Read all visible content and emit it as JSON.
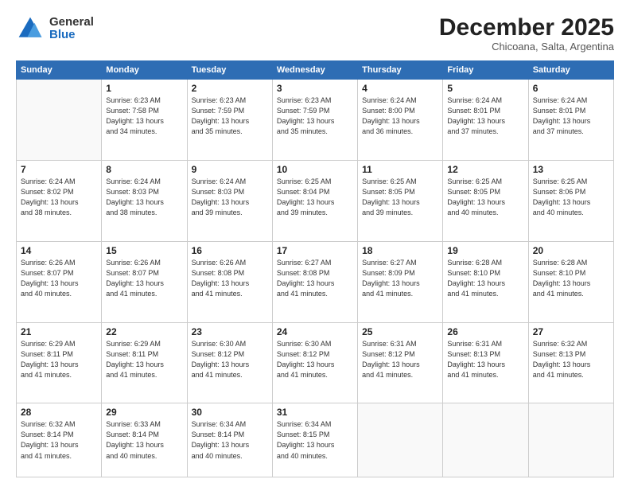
{
  "logo": {
    "general": "General",
    "blue": "Blue"
  },
  "header": {
    "month": "December 2025",
    "location": "Chicoana, Salta, Argentina"
  },
  "days_of_week": [
    "Sunday",
    "Monday",
    "Tuesday",
    "Wednesday",
    "Thursday",
    "Friday",
    "Saturday"
  ],
  "weeks": [
    [
      {
        "day": "",
        "info": ""
      },
      {
        "day": "1",
        "info": "Sunrise: 6:23 AM\nSunset: 7:58 PM\nDaylight: 13 hours\nand 34 minutes."
      },
      {
        "day": "2",
        "info": "Sunrise: 6:23 AM\nSunset: 7:59 PM\nDaylight: 13 hours\nand 35 minutes."
      },
      {
        "day": "3",
        "info": "Sunrise: 6:23 AM\nSunset: 7:59 PM\nDaylight: 13 hours\nand 35 minutes."
      },
      {
        "day": "4",
        "info": "Sunrise: 6:24 AM\nSunset: 8:00 PM\nDaylight: 13 hours\nand 36 minutes."
      },
      {
        "day": "5",
        "info": "Sunrise: 6:24 AM\nSunset: 8:01 PM\nDaylight: 13 hours\nand 37 minutes."
      },
      {
        "day": "6",
        "info": "Sunrise: 6:24 AM\nSunset: 8:01 PM\nDaylight: 13 hours\nand 37 minutes."
      }
    ],
    [
      {
        "day": "7",
        "info": "Sunrise: 6:24 AM\nSunset: 8:02 PM\nDaylight: 13 hours\nand 38 minutes."
      },
      {
        "day": "8",
        "info": "Sunrise: 6:24 AM\nSunset: 8:03 PM\nDaylight: 13 hours\nand 38 minutes."
      },
      {
        "day": "9",
        "info": "Sunrise: 6:24 AM\nSunset: 8:03 PM\nDaylight: 13 hours\nand 39 minutes."
      },
      {
        "day": "10",
        "info": "Sunrise: 6:25 AM\nSunset: 8:04 PM\nDaylight: 13 hours\nand 39 minutes."
      },
      {
        "day": "11",
        "info": "Sunrise: 6:25 AM\nSunset: 8:05 PM\nDaylight: 13 hours\nand 39 minutes."
      },
      {
        "day": "12",
        "info": "Sunrise: 6:25 AM\nSunset: 8:05 PM\nDaylight: 13 hours\nand 40 minutes."
      },
      {
        "day": "13",
        "info": "Sunrise: 6:25 AM\nSunset: 8:06 PM\nDaylight: 13 hours\nand 40 minutes."
      }
    ],
    [
      {
        "day": "14",
        "info": "Sunrise: 6:26 AM\nSunset: 8:07 PM\nDaylight: 13 hours\nand 40 minutes."
      },
      {
        "day": "15",
        "info": "Sunrise: 6:26 AM\nSunset: 8:07 PM\nDaylight: 13 hours\nand 41 minutes."
      },
      {
        "day": "16",
        "info": "Sunrise: 6:26 AM\nSunset: 8:08 PM\nDaylight: 13 hours\nand 41 minutes."
      },
      {
        "day": "17",
        "info": "Sunrise: 6:27 AM\nSunset: 8:08 PM\nDaylight: 13 hours\nand 41 minutes."
      },
      {
        "day": "18",
        "info": "Sunrise: 6:27 AM\nSunset: 8:09 PM\nDaylight: 13 hours\nand 41 minutes."
      },
      {
        "day": "19",
        "info": "Sunrise: 6:28 AM\nSunset: 8:10 PM\nDaylight: 13 hours\nand 41 minutes."
      },
      {
        "day": "20",
        "info": "Sunrise: 6:28 AM\nSunset: 8:10 PM\nDaylight: 13 hours\nand 41 minutes."
      }
    ],
    [
      {
        "day": "21",
        "info": "Sunrise: 6:29 AM\nSunset: 8:11 PM\nDaylight: 13 hours\nand 41 minutes."
      },
      {
        "day": "22",
        "info": "Sunrise: 6:29 AM\nSunset: 8:11 PM\nDaylight: 13 hours\nand 41 minutes."
      },
      {
        "day": "23",
        "info": "Sunrise: 6:30 AM\nSunset: 8:12 PM\nDaylight: 13 hours\nand 41 minutes."
      },
      {
        "day": "24",
        "info": "Sunrise: 6:30 AM\nSunset: 8:12 PM\nDaylight: 13 hours\nand 41 minutes."
      },
      {
        "day": "25",
        "info": "Sunrise: 6:31 AM\nSunset: 8:12 PM\nDaylight: 13 hours\nand 41 minutes."
      },
      {
        "day": "26",
        "info": "Sunrise: 6:31 AM\nSunset: 8:13 PM\nDaylight: 13 hours\nand 41 minutes."
      },
      {
        "day": "27",
        "info": "Sunrise: 6:32 AM\nSunset: 8:13 PM\nDaylight: 13 hours\nand 41 minutes."
      }
    ],
    [
      {
        "day": "28",
        "info": "Sunrise: 6:32 AM\nSunset: 8:14 PM\nDaylight: 13 hours\nand 41 minutes."
      },
      {
        "day": "29",
        "info": "Sunrise: 6:33 AM\nSunset: 8:14 PM\nDaylight: 13 hours\nand 40 minutes."
      },
      {
        "day": "30",
        "info": "Sunrise: 6:34 AM\nSunset: 8:14 PM\nDaylight: 13 hours\nand 40 minutes."
      },
      {
        "day": "31",
        "info": "Sunrise: 6:34 AM\nSunset: 8:15 PM\nDaylight: 13 hours\nand 40 minutes."
      },
      {
        "day": "",
        "info": ""
      },
      {
        "day": "",
        "info": ""
      },
      {
        "day": "",
        "info": ""
      }
    ]
  ]
}
